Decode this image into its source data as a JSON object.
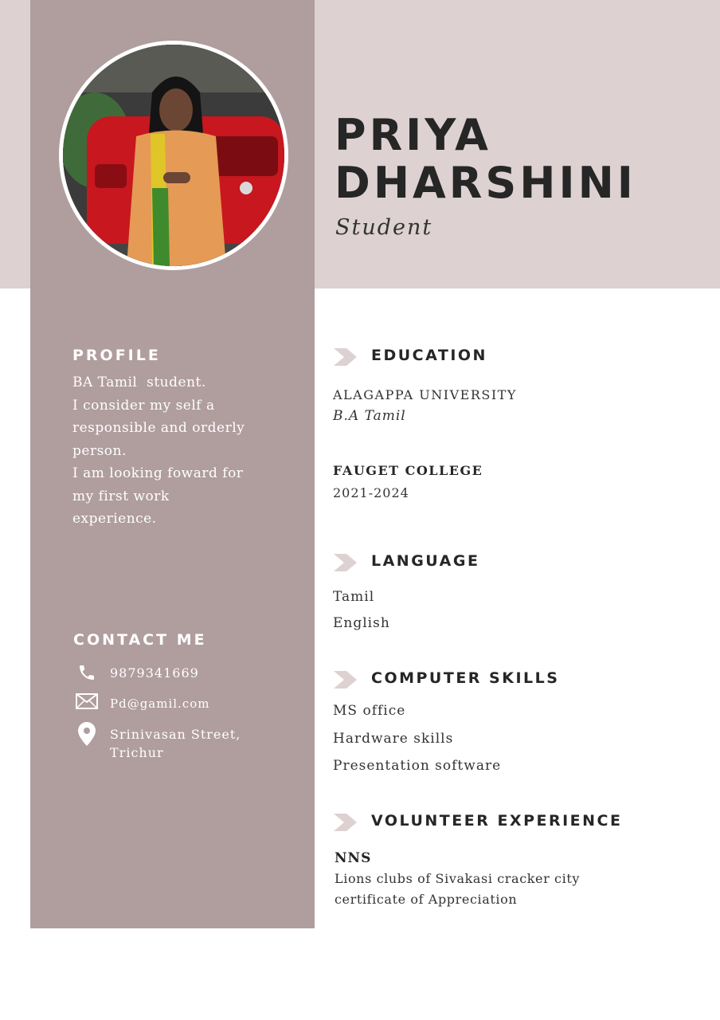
{
  "header": {
    "name_line1": "PRIYA",
    "name_line2": "DHARSHINI",
    "role": "Student"
  },
  "profile": {
    "heading": "PROFILE",
    "lines": [
      "BA Tamil  student.",
      "I consider my self a",
      "responsible and orderly",
      "person.",
      "I am looking foward for",
      "my first work",
      "experience."
    ]
  },
  "contact": {
    "heading": "CONTACT ME",
    "phone": "9879341669",
    "email": "Pd@gamil.com",
    "address_line1": "Srinivasan Street,",
    "address_line2": "Trichur",
    "icons": [
      "phone-icon",
      "mail-icon",
      "location-pin-icon"
    ]
  },
  "education": {
    "heading": "EDUCATION",
    "university": "ALAGAPPA UNIVERSITY",
    "degree": "B.A Tamil",
    "college": "FAUGET COLLEGE",
    "years": "2021-2024"
  },
  "language": {
    "heading": "LANGUAGE",
    "items": [
      "Tamil",
      "English"
    ]
  },
  "computer_skills": {
    "heading": "COMPUTER SKILLS",
    "items": [
      "MS office",
      "Hardware skills",
      "Presentation software"
    ]
  },
  "volunteer": {
    "heading": "VOLUNTEER EXPERIENCE",
    "org": "NNS",
    "line1": "Lions clubs of Sivakasi cracker city",
    "line2": "certificate of Appreciation"
  },
  "colors": {
    "sidebar": "#b09d9e",
    "header_band": "#ddd1d2",
    "arrow": "#ddd1d2",
    "dark_text": "#262626"
  }
}
